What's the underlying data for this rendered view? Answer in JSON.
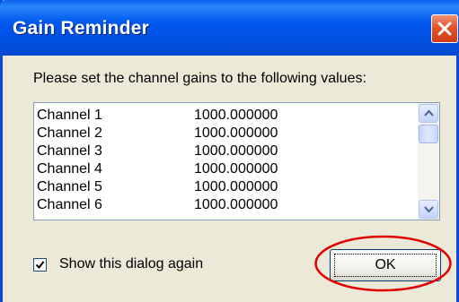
{
  "window": {
    "title": "Gain Reminder",
    "title_color": "#ffffff",
    "titlebar_color": "#0058ee"
  },
  "close_button": {
    "icon": "close-icon",
    "color": "#e2542d"
  },
  "prompt": "Please set the channel gains to the following values:",
  "channel_list": {
    "items": [
      {
        "channel": "Channel 1",
        "gain": "1000.000000"
      },
      {
        "channel": "Channel 2",
        "gain": "1000.000000"
      },
      {
        "channel": "Channel 3",
        "gain": "1000.000000"
      },
      {
        "channel": "Channel 4",
        "gain": "1000.000000"
      },
      {
        "channel": "Channel 5",
        "gain": "1000.000000"
      },
      {
        "channel": "Channel 6",
        "gain": "1000.000000"
      }
    ],
    "scroll_up_icon": "chevron-up-icon",
    "scroll_down_icon": "chevron-down-icon"
  },
  "show_again": {
    "label": "Show this dialog again",
    "checked": true
  },
  "ok_button": {
    "label": "OK"
  },
  "annotation": {
    "color": "#e00000"
  }
}
